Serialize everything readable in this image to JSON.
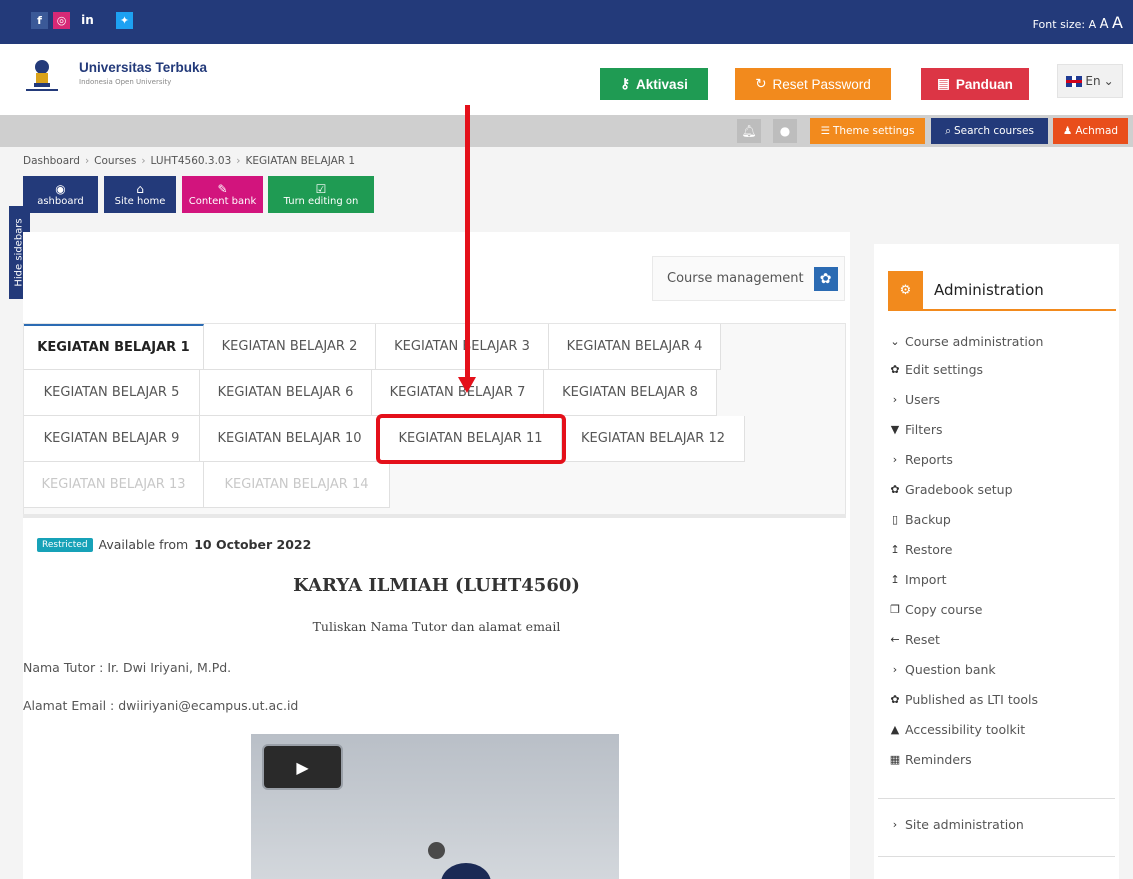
{
  "topbar": {
    "social": [
      "f",
      "ig",
      "in",
      "tw"
    ],
    "fontsize_label": "Font size:",
    "fontsize_a": [
      "A",
      "A",
      "A"
    ]
  },
  "header": {
    "logo_title": "Universitas Terbuka",
    "logo_subtitle": "Indonesia Open University",
    "buttons": {
      "aktivasi": "Aktivasi",
      "reset": "Reset Password",
      "panduan": "Panduan"
    },
    "lang": "En"
  },
  "navbar": {
    "theme": "Theme settings",
    "search": "Search courses",
    "user": "Achmad"
  },
  "breadcrumb": [
    "Dashboard",
    "Courses",
    "LUHT4560.3.03",
    "KEGIATAN BELAJAR 1"
  ],
  "quick": {
    "dashboard": "ashboard",
    "site_home": "Site home",
    "content_bank": "Content bank",
    "turn_editing": "Turn editing on"
  },
  "hide_sidebars": "Hide sidebars",
  "course_management": "Course management",
  "tabs": [
    "KEGIATAN BELAJAR 1",
    "KEGIATAN BELAJAR 2",
    "KEGIATAN BELAJAR 3",
    "KEGIATAN BELAJAR 4",
    "KEGIATAN BELAJAR 5",
    "KEGIATAN BELAJAR 6",
    "KEGIATAN BELAJAR 7",
    "KEGIATAN BELAJAR 8",
    "KEGIATAN BELAJAR 9",
    "KEGIATAN BELAJAR 10",
    "KEGIATAN BELAJAR 11",
    "KEGIATAN BELAJAR 12",
    "KEGIATAN BELAJAR 13",
    "KEGIATAN BELAJAR 14"
  ],
  "content": {
    "badge": "Restricted",
    "available_text": "Available from",
    "available_date": "10 October 2022",
    "title": "KARYA ILMIAH (LUHT4560)",
    "subtitle": "Tuliskan Nama Tutor dan alamat email",
    "tutor": "Nama Tutor : Ir. Dwi Iriyani, M.Pd.",
    "email": "Alamat Email : dwiiriyani@ecampus.ut.ac.id"
  },
  "admin": {
    "title": "Administration",
    "course_admin": "Course administration",
    "items": [
      "Edit settings",
      "Users",
      "Filters",
      "Reports",
      "Gradebook setup",
      "Backup",
      "Restore",
      "Import",
      "Copy course",
      "Reset",
      "Question bank",
      "Published as LTI tools",
      "Accessibility toolkit",
      "Reminders"
    ],
    "site_admin": "Site administration"
  },
  "colors": {
    "brand_blue": "#233a7a",
    "orange": "#f28a1d",
    "green": "#1f9b53",
    "red": "#dc3545",
    "annotation_red": "#e4101a"
  }
}
